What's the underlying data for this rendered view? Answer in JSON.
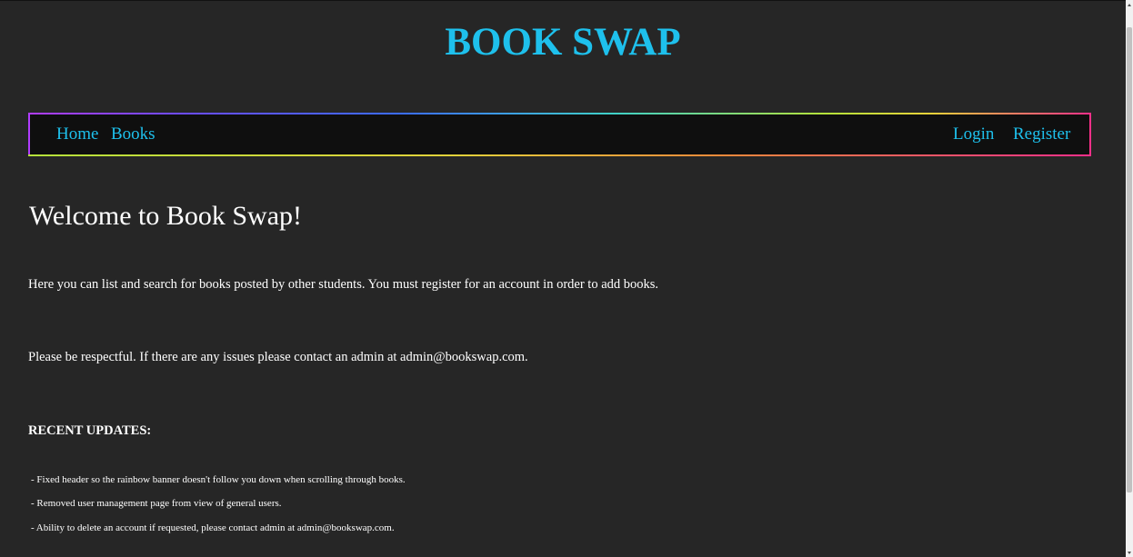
{
  "header": {
    "title": "BOOK SWAP"
  },
  "nav": {
    "left": [
      {
        "label": "Home"
      },
      {
        "label": "Books"
      }
    ],
    "right": [
      {
        "label": "Login"
      },
      {
        "label": "Register"
      }
    ]
  },
  "main": {
    "heading": "Welcome to Book Swap!",
    "paragraphs": [
      "Here you can list and search for books posted by other students. You must register for an account in order to add books.",
      "Please be respectful. If there are any issues please contact an admin at admin@bookswap.com."
    ],
    "updates_heading": "RECENT UPDATES:",
    "updates": [
      "- Fixed header so the rainbow banner doesn't follow you down when scrolling through books.",
      "- Removed user management page from view of general users.",
      "- Ability to delete an account if requested, please contact admin at admin@bookswap.com."
    ]
  },
  "colors": {
    "background": "#262626",
    "accent": "#1ec0ec",
    "navbar_bg": "#0f0f0f",
    "text": "#ffffff"
  },
  "icons": {
    "scroll_up": "chevron-up-icon",
    "scroll_down": "chevron-down-icon"
  }
}
